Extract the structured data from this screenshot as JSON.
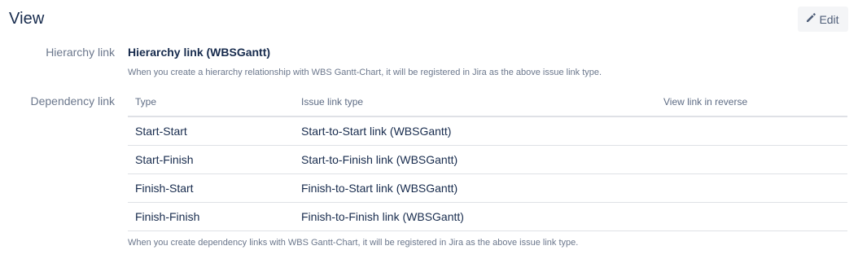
{
  "header": {
    "title": "View",
    "edit_label": "Edit",
    "edit_icon": "pencil-icon"
  },
  "hierarchy": {
    "label": "Hierarchy link",
    "value": "Hierarchy link (WBSGantt)",
    "help": "When you create a hierarchy relationship with WBS Gantt-Chart, it will be registered in Jira as the above issue link type."
  },
  "dependency": {
    "label": "Dependency link",
    "columns": [
      "Type",
      "Issue link type",
      "View link in reverse"
    ],
    "rows": [
      {
        "type": "Start-Start",
        "link": "Start-to-Start link (WBSGantt)",
        "reverse": ""
      },
      {
        "type": "Start-Finish",
        "link": "Start-to-Finish link (WBSGantt)",
        "reverse": ""
      },
      {
        "type": "Finish-Start",
        "link": "Finish-to-Start link (WBSGantt)",
        "reverse": ""
      },
      {
        "type": "Finish-Finish",
        "link": "Finish-to-Finish link (WBSGantt)",
        "reverse": ""
      }
    ],
    "help": "When you create dependency links with WBS Gantt-Chart, it will be registered in Jira as the above issue link type."
  },
  "colors": {
    "text": "#172b4d",
    "muted": "#6b778c",
    "button_bg": "#f4f5f7",
    "divider": "#dfe1e6"
  }
}
